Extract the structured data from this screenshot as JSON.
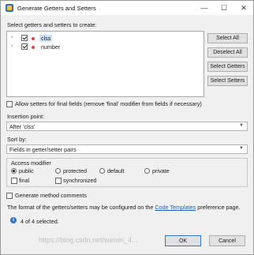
{
  "window": {
    "title": "Generate Getters and Setters",
    "min_glyph": "—",
    "max_glyph": "☐",
    "close_glyph": "✕"
  },
  "select_label": "Select getters and setters to create:",
  "tree": {
    "items": [
      {
        "name": "clss",
        "checked": true,
        "selected": true
      },
      {
        "name": "number",
        "checked": true,
        "selected": false
      }
    ]
  },
  "side_buttons": {
    "select_all": "Select All",
    "deselect_all": "Deselect All",
    "select_getters": "Select Getters",
    "select_setters": "Select Setters"
  },
  "allow_setters": {
    "label": "Allow setters for final fields (remove 'final' modifier from fields if necessary)",
    "checked": false
  },
  "insertion_point": {
    "label": "Insertion point:",
    "value": "After 'clss'"
  },
  "sort_by": {
    "label": "Sort by:",
    "value": "Fields in getter/setter pairs"
  },
  "access_modifier": {
    "legend": "Access modifier",
    "public": "public",
    "protected": "protected",
    "default": "default",
    "private": "private",
    "selected": "public",
    "final": "final",
    "synchronized": "synchronized"
  },
  "generate_comments": {
    "label": "Generate method comments",
    "checked": false
  },
  "format_text": {
    "before": "The format of the getters/setters may be configured on the",
    "link": "Code Templates",
    "after": "preference page."
  },
  "status": {
    "icon": "info-icon",
    "text": "4 of 4 selected."
  },
  "buttons": {
    "ok": "OK",
    "cancel": "Cancel"
  },
  "watermark": "https://blog.csdn.net/weixin_4..."
}
